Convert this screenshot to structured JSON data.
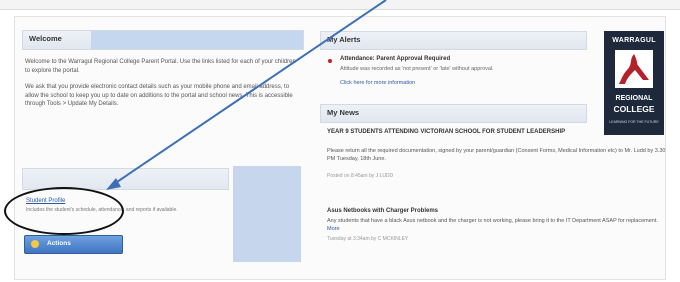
{
  "welcome": {
    "title": "Welcome",
    "para1": "Welcome to the Warragul Regional College Parent Portal. Use the links listed for each of your children to explore the portal.",
    "para2": "We ask that you provide electronic contact details such as your mobile phone and email address, to allow the school to keep you up to date on additions to the portal and school news. This is accessible through Tools > Update My Details."
  },
  "student": {
    "link": "Student Profile",
    "description": "Includes the student's schedule, attendance, and reports if available."
  },
  "actions_button": {
    "label": "Actions",
    "icon": "actions-icon"
  },
  "alerts": {
    "title": "My Alerts",
    "item_title": "Attendance: Parent Approval Required",
    "item_text": "Attitude was recorded as 'not present' or 'late' without approval.",
    "item_link": "Click here for more information"
  },
  "news": {
    "title": "My News",
    "items": [
      {
        "title": "YEAR 9 STUDENTS ATTENDING VICTORIAN SCHOOL FOR STUDENT LEADERSHIP",
        "body": "Please return all the required documentation, signed by your parent/guardian (Consent Forms, Medical Information etc) to Mr. Ludd by 3.30 PM Tuesday, 18th June.",
        "meta": "Posted on 8:45am by J LUDD"
      },
      {
        "title": "Asus Netbooks with Charger Problems",
        "body": "Any students that have a black Asus netbook and the charger is not working, please bring it to the IT Department ASAP for replacement.",
        "link": "More",
        "meta": "Tuesday at 3:34am by C MCKINLEY"
      }
    ]
  },
  "logo": {
    "top": "WARRAGUL",
    "line1": "REGIONAL",
    "line2": "COLLEGE",
    "tagline": "LEARNING FOR THE FUTURE",
    "colors": {
      "background": "#1e2a3c",
      "mark": "#b3222b"
    }
  },
  "annotation": {
    "arrow_color": "#3d6fb6",
    "ellipse_color": "#111111"
  }
}
